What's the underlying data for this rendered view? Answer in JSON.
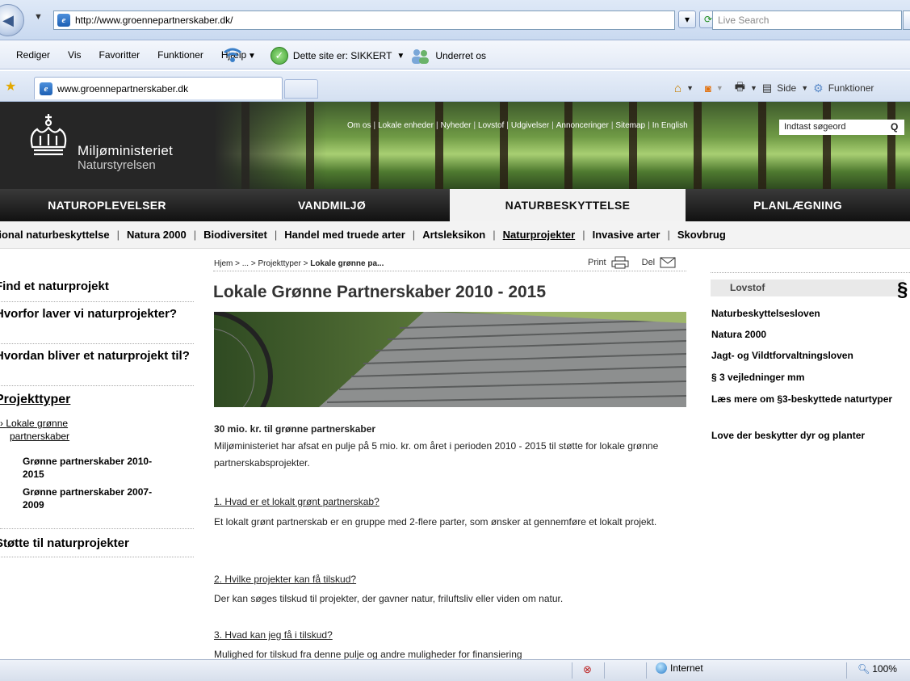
{
  "browser": {
    "address": "http://www.groennepartnerskaber.dk/",
    "search_placeholder": "Live Search",
    "menu": [
      "Rediger",
      "Vis",
      "Favoritter",
      "Funktioner",
      "Hjælp"
    ],
    "safety_text": "Dette site er: SIKKERT",
    "notify_text": "Underret os",
    "tab_title": "www.groennepartnerskaber.dk",
    "cmd_page": "Side",
    "cmd_tools": "Funktioner",
    "status_zone": "Internet",
    "zoom": "100%"
  },
  "site": {
    "ministry": "Miljøministeriet",
    "agency": "Naturstyrelsen",
    "top_links": [
      "Om os",
      "Lokale enheder",
      "Nyheder",
      "Lovstof",
      "Udgivelser",
      "Annonceringer",
      "Sitemap",
      "In English"
    ],
    "search_placeholder": "Indtast søgeord",
    "main_nav": [
      "NATUROPLEVELSER",
      "VANDMILJØ",
      "NATURBESKYTTELSE",
      "PLANLÆGNING"
    ],
    "sub_nav": [
      "tional naturbeskyttelse",
      "Natura 2000",
      "Biodiversitet",
      "Handel med truede arter",
      "Artsleksikon",
      "Naturprojekter",
      "Invasive arter",
      "Skovbrug"
    ]
  },
  "left": {
    "find": "Find et naturprojekt",
    "why": "Hvorfor laver vi naturprojekter?",
    "how": "Hvordan bliver et naturprojekt til?",
    "types": "Projekttyper",
    "local": "Lokale grønne partnerskaber",
    "gp1015": "Grønne partnerskaber 2010-2015",
    "gp0709": "Grønne partnerskaber 2007-2009",
    "support": "Støtte til naturprojekter"
  },
  "center": {
    "breadcrumb_prefix": "Hjem > ... > Projekttyper > ",
    "breadcrumb_current": "Lokale grønne pa...",
    "print": "Print",
    "share": "Del",
    "title": "Lokale Grønne Partnerskaber 2010 - 2015",
    "intro_heading": "30 mio. kr. til grønne partnerskaber",
    "intro_text": "Miljøministeriet har afsat en pulje på 5 mio. kr. om året i perioden 2010 - 2015 til  støtte for lokale grønne partnerskabsprojekter.",
    "q1": "1. Hvad er et lokalt grønt partnerskab?",
    "a1": "Et lokalt grønt partnerskab er en gruppe med 2-flere parter, som ønsker at gennemføre et lokalt projekt.",
    "q2": "2. Hvilke projekter kan få tilskud?",
    "a2": "Der kan søges tilskud til projekter, der gavner natur, friluftsliv eller viden om natur.",
    "q3": "3. Hvad kan jeg få i tilskud?",
    "a3": "Mulighed for tilskud fra denne pulje og andre muligheder for finansiering"
  },
  "right": {
    "box_title": "Lovstof",
    "links": [
      "Naturbeskyttelsesloven",
      "Natura 2000",
      "Jagt- og Vildtforvaltningsloven",
      "§ 3 vejledninger mm",
      "Læs mere om §3-beskyttede naturtyper",
      "Love der beskytter dyr og planter"
    ]
  }
}
